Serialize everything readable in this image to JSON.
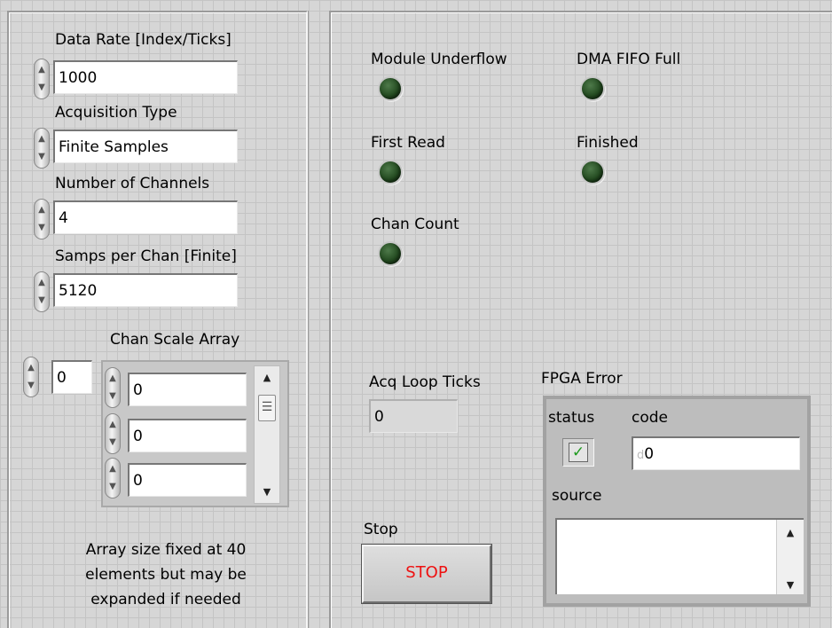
{
  "left": {
    "data_rate": {
      "label": "Data Rate [Index/Ticks]",
      "value": "1000"
    },
    "acquisition_type": {
      "label": "Acquisition Type",
      "value": "Finite Samples"
    },
    "num_channels": {
      "label": "Number of Channels",
      "value": "4"
    },
    "samps_per_chan": {
      "label": "Samps per Chan [Finite]",
      "value": "5120"
    },
    "chan_scale_array": {
      "label": "Chan Scale Array",
      "index": "0",
      "elements": [
        "0",
        "0",
        "0"
      ]
    },
    "note": [
      "Array size fixed at 40",
      "elements but may be",
      "expanded if needed"
    ]
  },
  "right": {
    "indicators": {
      "module_underflow": "Module Underflow",
      "dma_fifo_full": "DMA FIFO Full",
      "first_read": "First Read",
      "finished": "Finished",
      "chan_count": "Chan Count"
    },
    "acq_loop_ticks": {
      "label": "Acq Loop Ticks",
      "value": "0"
    },
    "fpga_error": {
      "label": "FPGA Error",
      "status_label": "status",
      "code_label": "code",
      "code_radix": "d",
      "code_value": "0",
      "source_label": "source",
      "source_value": ""
    },
    "stop": {
      "label": "Stop",
      "button_text": "STOP"
    }
  },
  "colors": {
    "led_off": "#234a20",
    "stop_text": "#ee1111",
    "check": "#1d9a1d"
  }
}
